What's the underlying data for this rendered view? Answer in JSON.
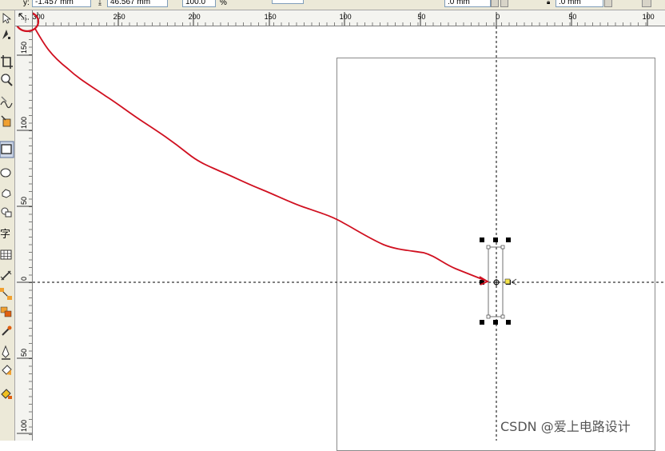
{
  "property_bar": {
    "y_label": "y:",
    "y_value": "-1.457 mm",
    "h_value": "46.567 mm",
    "scale_value": "100.0",
    "scale_unit": "%",
    "field_a": ".0 mm",
    "field_b": ".0 mm"
  },
  "toolbox": {
    "tools": [
      {
        "name": "pick-tool-icon"
      },
      {
        "name": "shape-tool-icon"
      },
      {
        "name": "crop-tool-icon"
      },
      {
        "name": "zoom-tool-icon"
      },
      {
        "name": "freehand-tool-icon"
      },
      {
        "name": "smart-fill-tool-icon"
      },
      {
        "name": "rectangle-tool-icon"
      },
      {
        "name": "ellipse-tool-icon"
      },
      {
        "name": "polygon-tool-icon"
      },
      {
        "name": "basic-shapes-tool-icon"
      },
      {
        "name": "text-tool-icon",
        "glyph": "字"
      },
      {
        "name": "table-tool-icon"
      },
      {
        "name": "dimension-tool-icon"
      },
      {
        "name": "connector-tool-icon"
      },
      {
        "name": "blend-tool-icon"
      },
      {
        "name": "eyedropper-tool-icon"
      },
      {
        "name": "outline-pen-tool-icon"
      },
      {
        "name": "fill-tool-icon"
      },
      {
        "name": "interactive-fill-tool-icon"
      }
    ]
  },
  "hruler": {
    "labels": [
      "300",
      "250",
      "200",
      "150",
      "100",
      "50",
      "0",
      "50",
      "100"
    ]
  },
  "vruler": {
    "labels": [
      "150",
      "100",
      "50",
      "0",
      "50",
      "100"
    ]
  },
  "watermark": "CSDN @爱上电路设计"
}
